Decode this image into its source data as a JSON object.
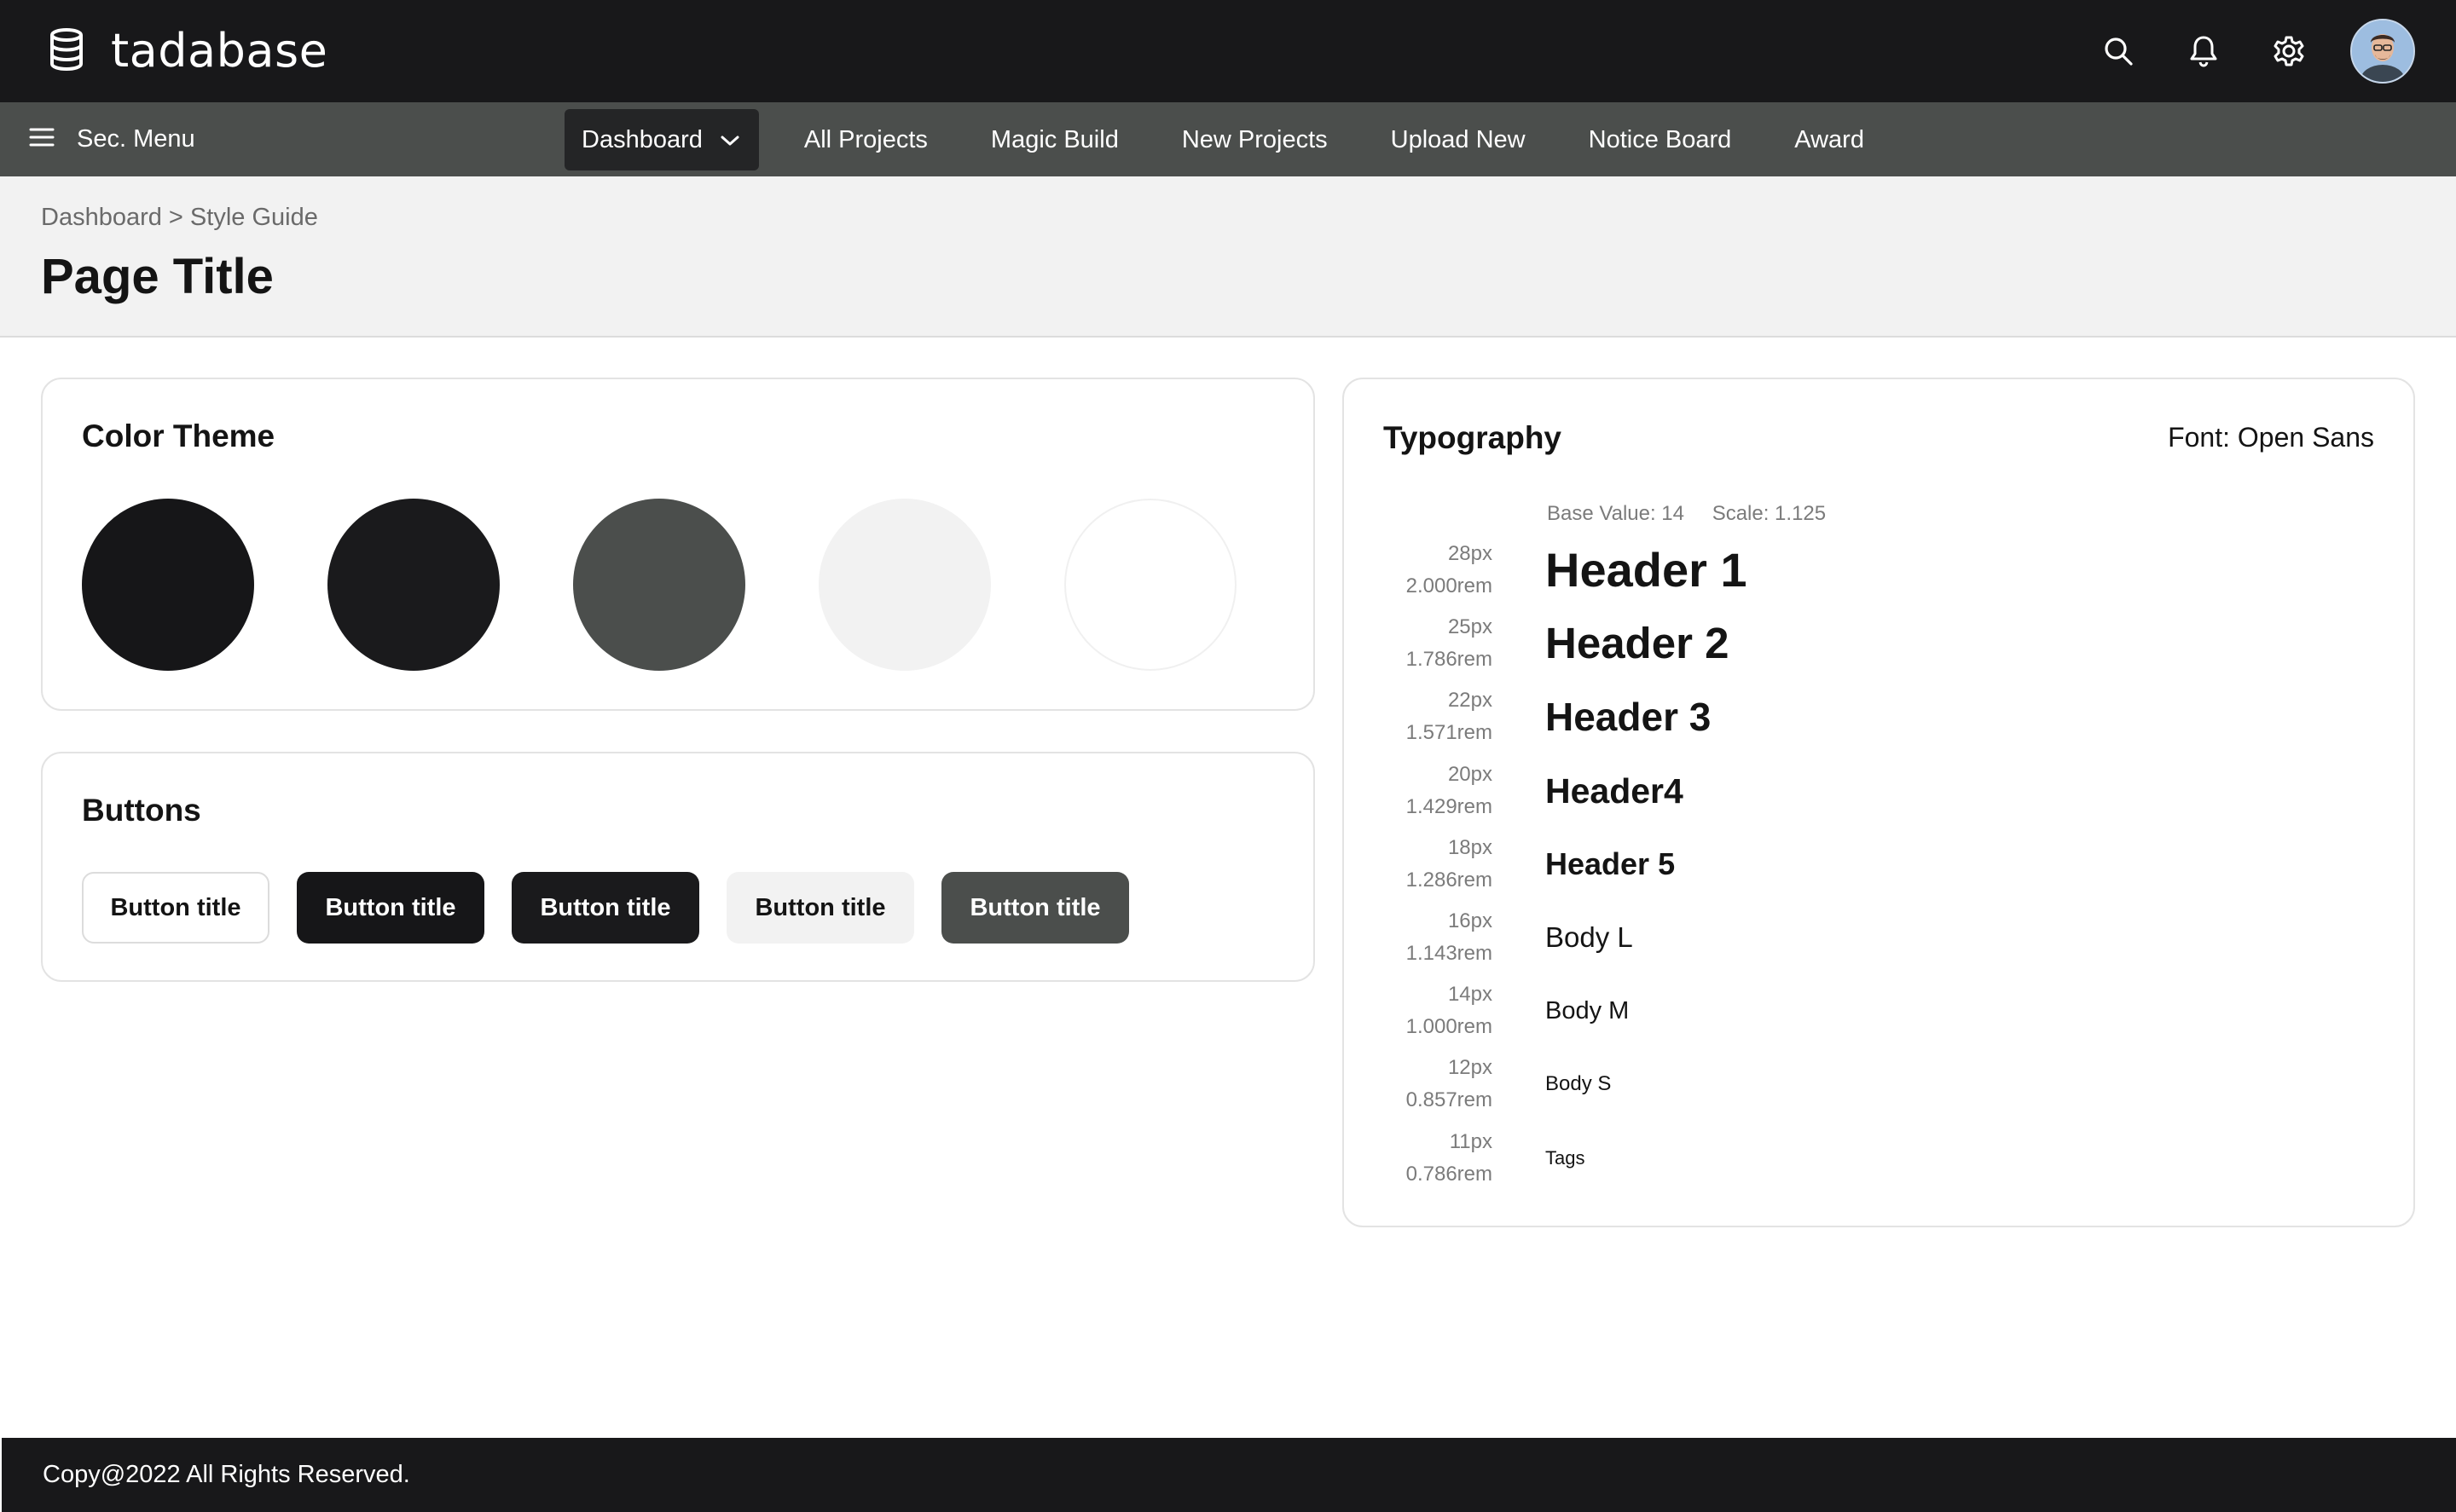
{
  "app": {
    "logo_text": "tadabase"
  },
  "topbar": {
    "icons": [
      "search-icon",
      "bell-icon",
      "gear-icon"
    ],
    "avatar": "user-avatar"
  },
  "nav": {
    "sec_menu_label": "Sec. Menu",
    "items": [
      {
        "label": "Dashboard",
        "active": true
      },
      {
        "label": "All Projects"
      },
      {
        "label": "Magic Build"
      },
      {
        "label": "New Projects"
      },
      {
        "label": "Upload New"
      },
      {
        "label": "Notice Board"
      },
      {
        "label": "Award"
      }
    ]
  },
  "header": {
    "breadcrumb": "Dashboard > Style Guide",
    "title": "Page Title"
  },
  "color_theme": {
    "title": "Color Theme",
    "swatches": [
      "#161618",
      "#1a1a1c",
      "#4b4e4c",
      "#f2f2f2",
      "#ffffff"
    ]
  },
  "buttons": {
    "title": "Buttons",
    "items": [
      {
        "label": "Button title",
        "variant": "outline",
        "bg": "#ffffff",
        "color": "#141414"
      },
      {
        "label": "Button title",
        "variant": "dark",
        "bg": "#161618",
        "color": "#ffffff"
      },
      {
        "label": "Button title",
        "variant": "dark-alt",
        "bg": "#1a1a1c",
        "color": "#ffffff"
      },
      {
        "label": "Button title",
        "variant": "light",
        "bg": "#f2f2f2",
        "color": "#141414"
      },
      {
        "label": "Button title",
        "variant": "gray",
        "bg": "#4b4e4c",
        "color": "#ffffff"
      }
    ]
  },
  "typography": {
    "title": "Typography",
    "font_label": "Font: Open Sans",
    "base_value": "Base Value: 14",
    "scale": "Scale: 1.125",
    "rows": [
      {
        "px": "28px",
        "rem": "2.000rem",
        "sample": "Header 1",
        "bold": true
      },
      {
        "px": "25px",
        "rem": "1.786rem",
        "sample": "Header 2",
        "bold": true
      },
      {
        "px": "22px",
        "rem": "1.571rem",
        "sample": "Header 3",
        "bold": true
      },
      {
        "px": "20px",
        "rem": "1.429rem",
        "sample": "Header4",
        "bold": true
      },
      {
        "px": "18px",
        "rem": "1.286rem",
        "sample": "Header 5",
        "bold": true
      },
      {
        "px": "16px",
        "rem": "1.143rem",
        "sample": "Body L",
        "bold": false
      },
      {
        "px": "14px",
        "rem": "1.000rem",
        "sample": "Body M",
        "bold": false
      },
      {
        "px": "12px",
        "rem": "0.857rem",
        "sample": "Body S",
        "bold": false
      },
      {
        "px": "11px",
        "rem": "0.786rem",
        "sample": "Tags",
        "bold": false
      }
    ]
  },
  "footer": {
    "text": "Copy@2022 All Rights Reserved."
  }
}
